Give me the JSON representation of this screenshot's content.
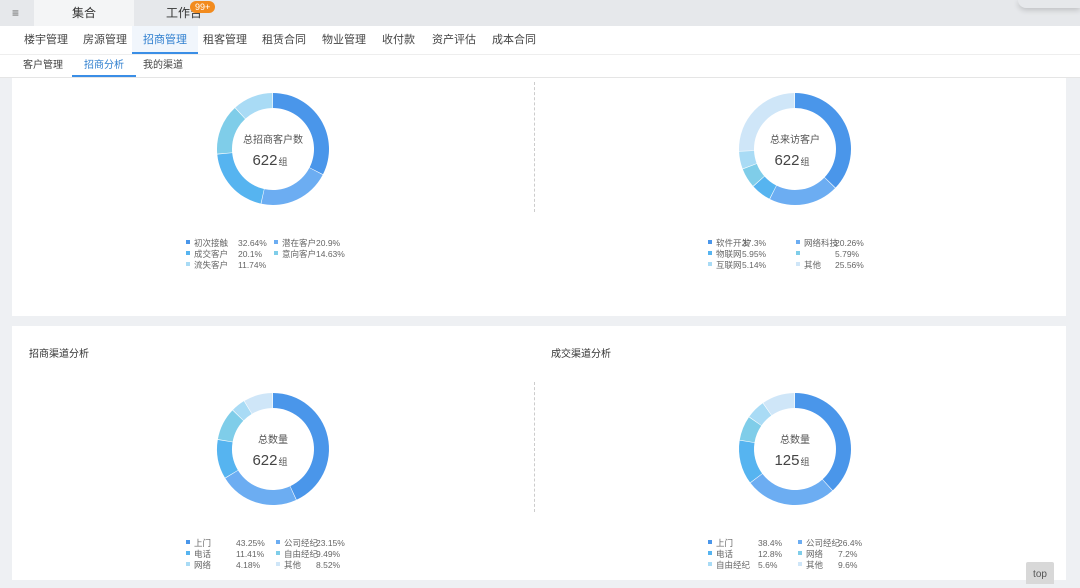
{
  "topbar": {
    "menu_icon": "list-menu-icon",
    "tabs": [
      {
        "label": "集合"
      },
      {
        "label": "工作台",
        "badge": "99+"
      }
    ]
  },
  "nav_primary": [
    "楼宇管理",
    "房源管理",
    "招商管理",
    "租客管理",
    "租赁合同",
    "物业管理",
    "收付款",
    "资产评估",
    "成本合同"
  ],
  "nav_secondary": [
    "客户管理",
    "招商分析",
    "我的渠道"
  ],
  "sections": {
    "channel_title": "招商渠道分析",
    "deal_title": "成交渠道分析"
  },
  "top_button": "top",
  "colors": {
    "blue1": "#4a96ea",
    "blue2": "#6cadf2",
    "blue3": "#56b4f0",
    "cyan": "#7fcde9",
    "light": "#a9dbf5",
    "pale": "#cfe6f8",
    "active_nav": "#3a8ee6",
    "badge": "#f28b1e"
  },
  "chart_data": [
    {
      "type": "pie",
      "donut": true,
      "center_label": "总招商客户数",
      "center_value": "622",
      "center_unit": "组",
      "slices": [
        {
          "name": "初次接触",
          "value": 32.64,
          "label": "32.64%",
          "color": "#4a96ea"
        },
        {
          "name": "潜在客户",
          "value": 20.9,
          "label": "20.9%",
          "color": "#6cadf2"
        },
        {
          "name": "成交客户",
          "value": 20.1,
          "label": "20.1%",
          "color": "#56b4f0"
        },
        {
          "name": "意向客户",
          "value": 14.63,
          "label": "14.63%",
          "color": "#7fcde9"
        },
        {
          "name": "流失客户",
          "value": 11.74,
          "label": "11.74%",
          "color": "#a9dbf5"
        }
      ]
    },
    {
      "type": "pie",
      "donut": true,
      "center_label": "总来访客户",
      "center_value": "622",
      "center_unit": "组",
      "slices": [
        {
          "name": "软件开发",
          "value": 37.3,
          "label": "37.3%",
          "color": "#4a96ea"
        },
        {
          "name": "网络科技",
          "value": 20.26,
          "label": "20.26%",
          "color": "#6cadf2"
        },
        {
          "name": "物联网",
          "value": 5.95,
          "label": "5.95%",
          "color": "#56b4f0"
        },
        {
          "name": "",
          "value": 5.79,
          "label": "5.79%",
          "color": "#7fcde9"
        },
        {
          "name": "互联网",
          "value": 5.14,
          "label": "5.14%",
          "color": "#a9dbf5"
        },
        {
          "name": "其他",
          "value": 25.56,
          "label": "25.56%",
          "color": "#cfe6f8"
        }
      ]
    },
    {
      "type": "pie",
      "donut": true,
      "center_label": "总数量",
      "center_value": "622",
      "center_unit": "组",
      "slices": [
        {
          "name": "上门",
          "value": 43.25,
          "label": "43.25%",
          "color": "#4a96ea"
        },
        {
          "name": "公司经纪",
          "value": 23.15,
          "label": "23.15%",
          "color": "#6cadf2"
        },
        {
          "name": "电话",
          "value": 11.41,
          "label": "11.41%",
          "color": "#56b4f0"
        },
        {
          "name": "自由经纪",
          "value": 9.49,
          "label": "9.49%",
          "color": "#7fcde9"
        },
        {
          "name": "网络",
          "value": 4.18,
          "label": "4.18%",
          "color": "#a9dbf5"
        },
        {
          "name": "其他",
          "value": 8.52,
          "label": "8.52%",
          "color": "#cfe6f8"
        }
      ]
    },
    {
      "type": "pie",
      "donut": true,
      "center_label": "总数量",
      "center_value": "125",
      "center_unit": "组",
      "slices": [
        {
          "name": "上门",
          "value": 38.4,
          "label": "38.4%",
          "color": "#4a96ea"
        },
        {
          "name": "公司经纪",
          "value": 26.4,
          "label": "26.4%",
          "color": "#6cadf2"
        },
        {
          "name": "电话",
          "value": 12.8,
          "label": "12.8%",
          "color": "#56b4f0"
        },
        {
          "name": "网络",
          "value": 7.2,
          "label": "7.2%",
          "color": "#7fcde9"
        },
        {
          "name": "自由经纪",
          "value": 5.6,
          "label": "5.6%",
          "color": "#a9dbf5"
        },
        {
          "name": "其他",
          "value": 9.6,
          "label": "9.6%",
          "color": "#cfe6f8"
        }
      ]
    }
  ]
}
